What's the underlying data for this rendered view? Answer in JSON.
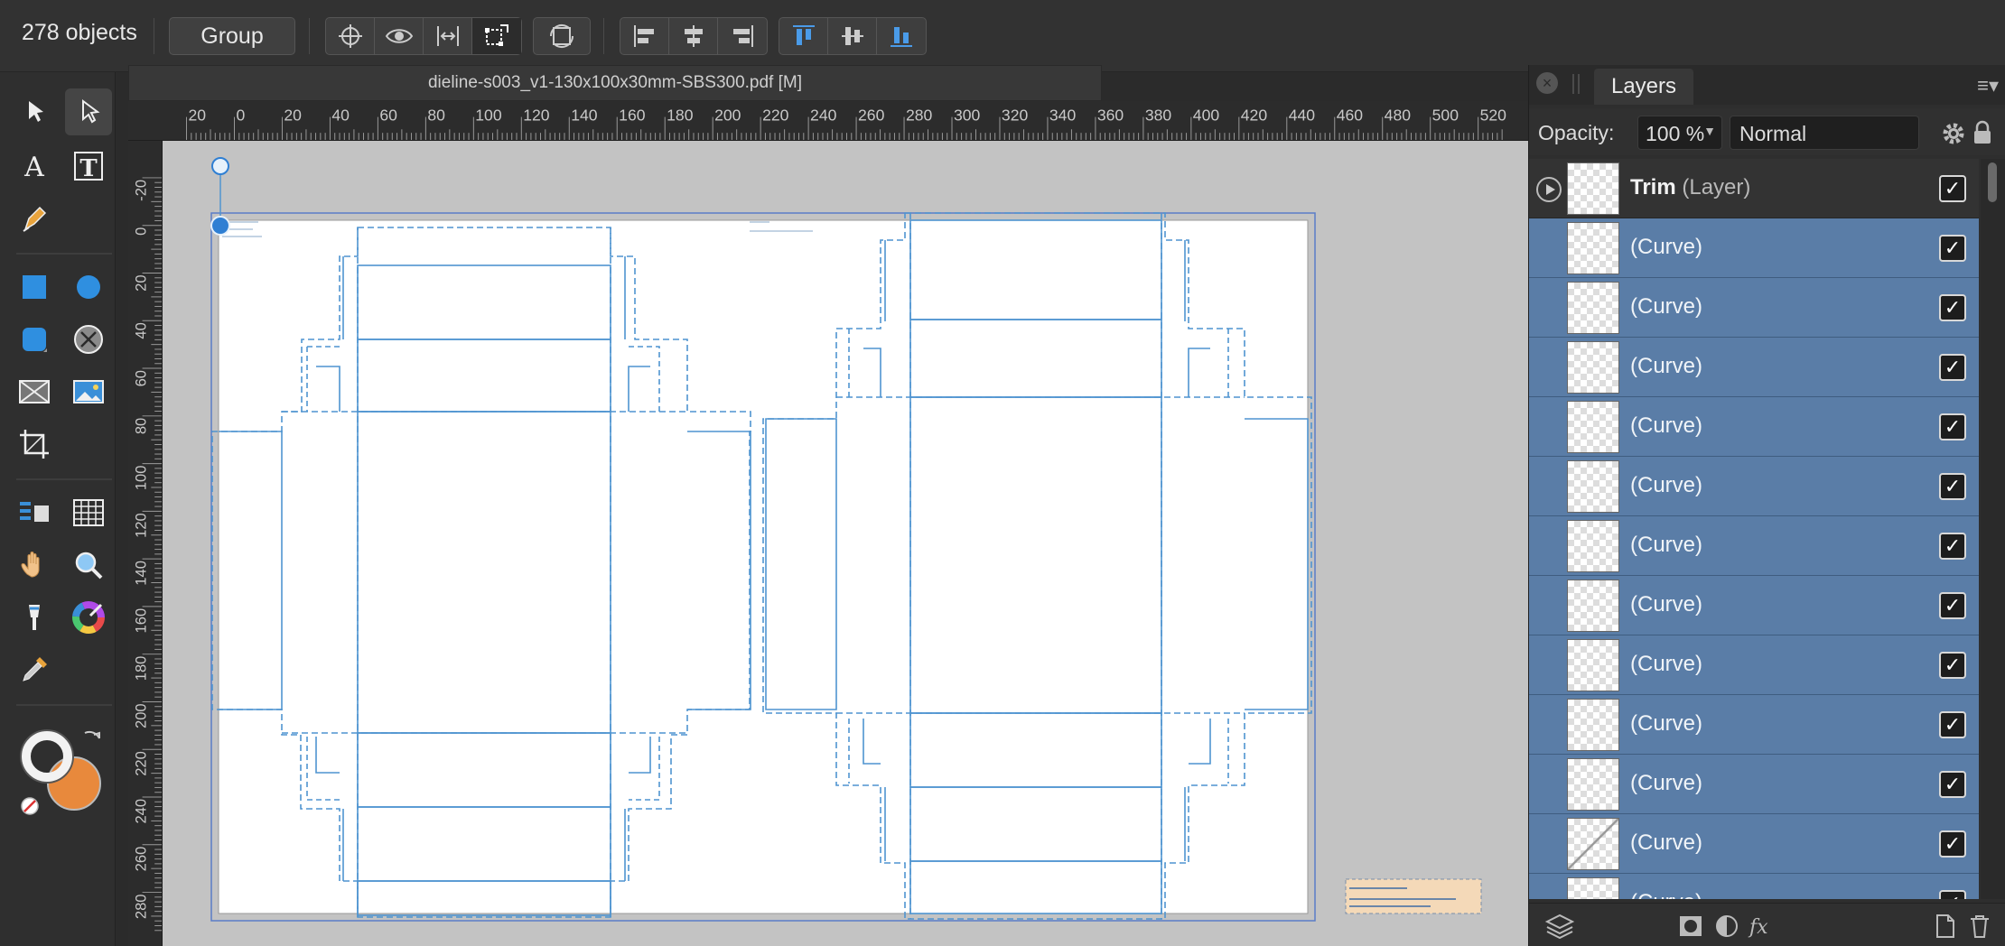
{
  "toolbar": {
    "object_count": "278 objects",
    "group_label": "Group"
  },
  "document": {
    "tab_title": "dieline-s003_v1-130x100x30mm-SBS300.pdf [M]"
  },
  "ruler": {
    "unit": "mm",
    "h_labels": [
      "20",
      "0",
      "20",
      "40",
      "60",
      "80",
      "100",
      "120",
      "140",
      "160",
      "180",
      "200",
      "220",
      "240",
      "260",
      "280",
      "300",
      "320",
      "340",
      "360",
      "380",
      "400",
      "420",
      "440",
      "460",
      "480",
      "500",
      "520"
    ],
    "v_labels": [
      "-20",
      "0",
      "20",
      "40",
      "60",
      "80",
      "100",
      "120",
      "140",
      "160",
      "180",
      "200",
      "220",
      "240",
      "260",
      "280"
    ]
  },
  "layers_panel": {
    "tab_label": "Layers",
    "opacity_label": "Opacity:",
    "opacity_value": "100 %",
    "blend_mode": "Normal",
    "top_layer": {
      "name": "Trim",
      "type": "(Layer)"
    },
    "curve_label": "(Curve)",
    "check": "✓"
  },
  "colors": {
    "accent": "#5a7da7",
    "selection": "#2f7fd3",
    "fill_accent": "#e8893c"
  }
}
